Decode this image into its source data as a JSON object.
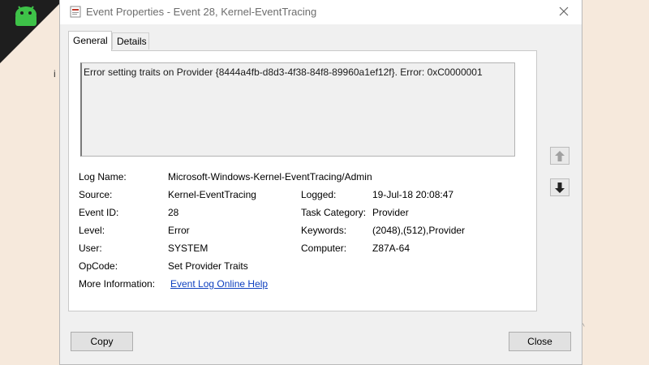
{
  "window": {
    "title": "Event Properties - Event 28, Kernel-EventTracing"
  },
  "tabs": [
    {
      "label": "General",
      "active": true
    },
    {
      "label": "Details",
      "active": false
    }
  ],
  "description": "Error setting traits on Provider {8444a4fb-d8d3-4f38-84f8-89960a1ef12f}. Error: 0xC0000001",
  "properties": {
    "log_name": {
      "label": "Log Name:",
      "value": "Microsoft-Windows-Kernel-EventTracing/Admin"
    },
    "source": {
      "label": "Source:",
      "value": "Kernel-EventTracing"
    },
    "logged": {
      "label": "Logged:",
      "value": "19-Jul-18 20:08:47"
    },
    "event_id": {
      "label": "Event ID:",
      "value": "28"
    },
    "task_category": {
      "label": "Task Category:",
      "value": "Provider"
    },
    "level": {
      "label": "Level:",
      "value": "Error"
    },
    "keywords": {
      "label": "Keywords:",
      "value": "(2048),(512),Provider"
    },
    "user": {
      "label": "User:",
      "value": "SYSTEM"
    },
    "computer": {
      "label": "Computer:",
      "value": "Z87A-64"
    },
    "opcode": {
      "label": "OpCode:",
      "value": "Set Provider Traits"
    },
    "more_info": {
      "label": "More Information:",
      "link": "Event Log Online Help"
    }
  },
  "buttons": {
    "copy": "Copy",
    "close": "Close"
  },
  "icons": {
    "close": "close-icon",
    "up": "arrow-up-icon",
    "down": "arrow-down-icon",
    "window": "event-viewer-icon",
    "logo": "android-logo-icon"
  },
  "background": {
    "edge_letter": "i",
    "speck": "^"
  },
  "colors": {
    "link": "#0d3fbf",
    "background": "#f6e9dc",
    "logo_green": "#3ec248"
  }
}
